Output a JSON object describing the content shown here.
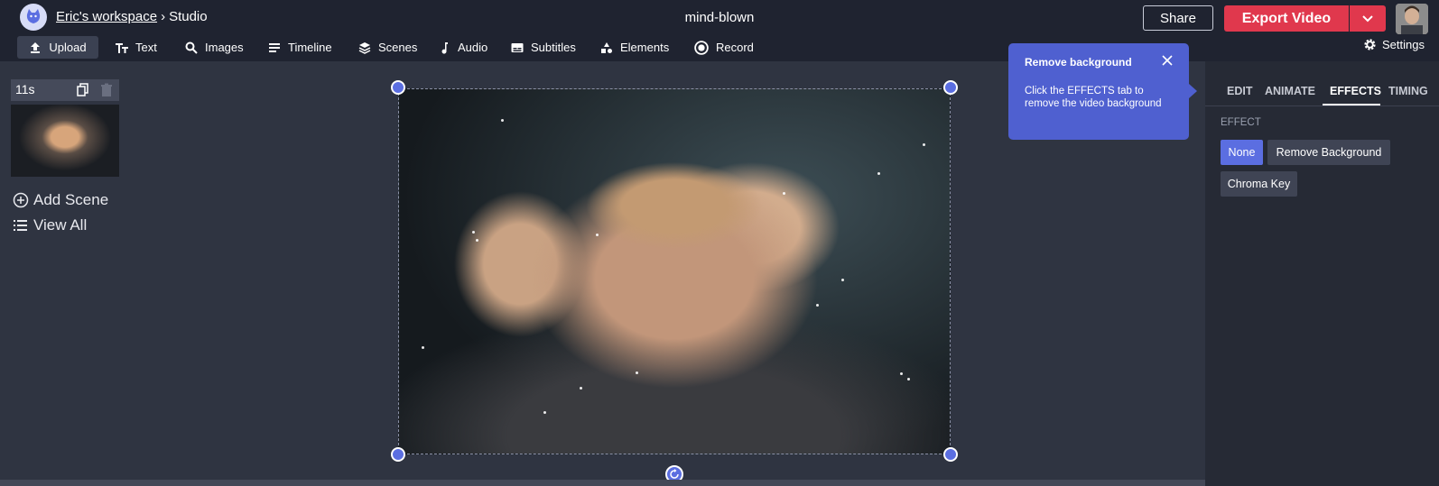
{
  "header": {
    "workspace": "Eric's workspace",
    "separator": "›",
    "section": "Studio",
    "project_title": "mind-blown",
    "share_label": "Share",
    "export_label": "Export Video",
    "settings_label": "Settings"
  },
  "toolbar": {
    "items": [
      {
        "label": "Upload",
        "icon": "upload-icon"
      },
      {
        "label": "Text",
        "icon": "text-icon"
      },
      {
        "label": "Images",
        "icon": "search-icon"
      },
      {
        "label": "Timeline",
        "icon": "timeline-icon"
      },
      {
        "label": "Scenes",
        "icon": "layers-icon"
      },
      {
        "label": "Audio",
        "icon": "music-note-icon"
      },
      {
        "label": "Subtitles",
        "icon": "subtitles-icon"
      },
      {
        "label": "Elements",
        "icon": "shapes-icon"
      },
      {
        "label": "Record",
        "icon": "record-icon"
      }
    ]
  },
  "scenes": {
    "duration": "11s",
    "add_scene_label": "Add Scene",
    "view_all_label": "View All"
  },
  "tooltip": {
    "title": "Remove background",
    "body": "Click the EFFECTS tab to remove the video background"
  },
  "right_panel": {
    "tabs": [
      "EDIT",
      "ANIMATE",
      "EFFECTS",
      "TIMING"
    ],
    "active_tab": "EFFECTS",
    "effect_label": "EFFECT",
    "effects": [
      "None",
      "Remove Background",
      "Chroma Key"
    ],
    "selected_effect": "None"
  },
  "colors": {
    "accent": "#5b6ee1",
    "export": "#e0384d",
    "topbar": "#1f2330",
    "canvas_bg": "#2f3441",
    "panel_bg": "#262a35"
  }
}
